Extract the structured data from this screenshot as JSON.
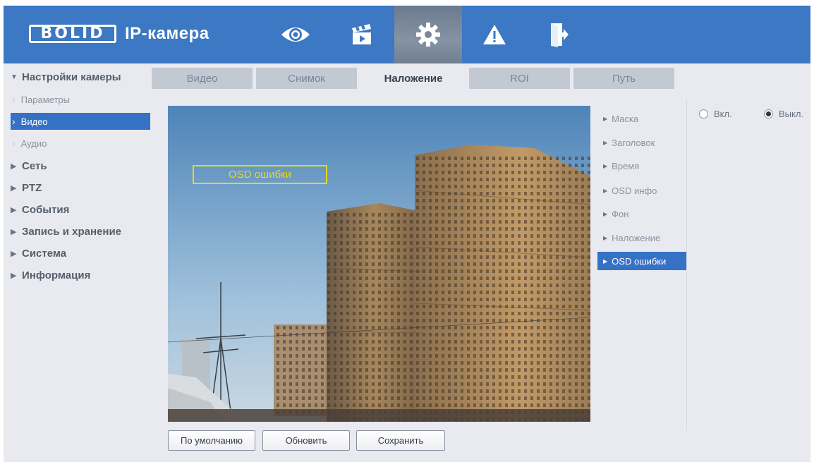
{
  "header": {
    "logo_text": "BOLID",
    "title": "IP-камера",
    "nav_icons": [
      "eye-icon",
      "clapperboard-icon",
      "gear-icon",
      "warning-icon",
      "logout-icon"
    ],
    "active_nav": "gear-icon",
    "colors": {
      "bar": "#3c78c3",
      "active_tab": "#7a8799"
    }
  },
  "sidebar": {
    "camera_settings": "Настройки камеры",
    "sub_items": [
      "Параметры",
      "Видео",
      "Аудио"
    ],
    "active_sub": "Видео",
    "sections": [
      "Сеть",
      "PTZ",
      "События",
      "Запись и хранение",
      "Система",
      "Информация"
    ]
  },
  "tabs": [
    "Видео",
    "Снимок",
    "Наложение",
    "ROI",
    "Путь"
  ],
  "active_tab": "Наложение",
  "preview": {
    "osd_label": "OSD ошибки"
  },
  "overlay_menu": [
    "Маска",
    "Заголовок",
    "Время",
    "OSD инфо",
    "Фон",
    "Наложение",
    "OSD ошибки"
  ],
  "active_overlay": "OSD ошибки",
  "radio": {
    "on_label": "Вкл.",
    "off_label": "Выкл.",
    "selected": "off"
  },
  "buttons": {
    "default": "По умолчанию",
    "refresh": "Обновить",
    "save": "Сохранить"
  },
  "accent_color": "#3572c6"
}
